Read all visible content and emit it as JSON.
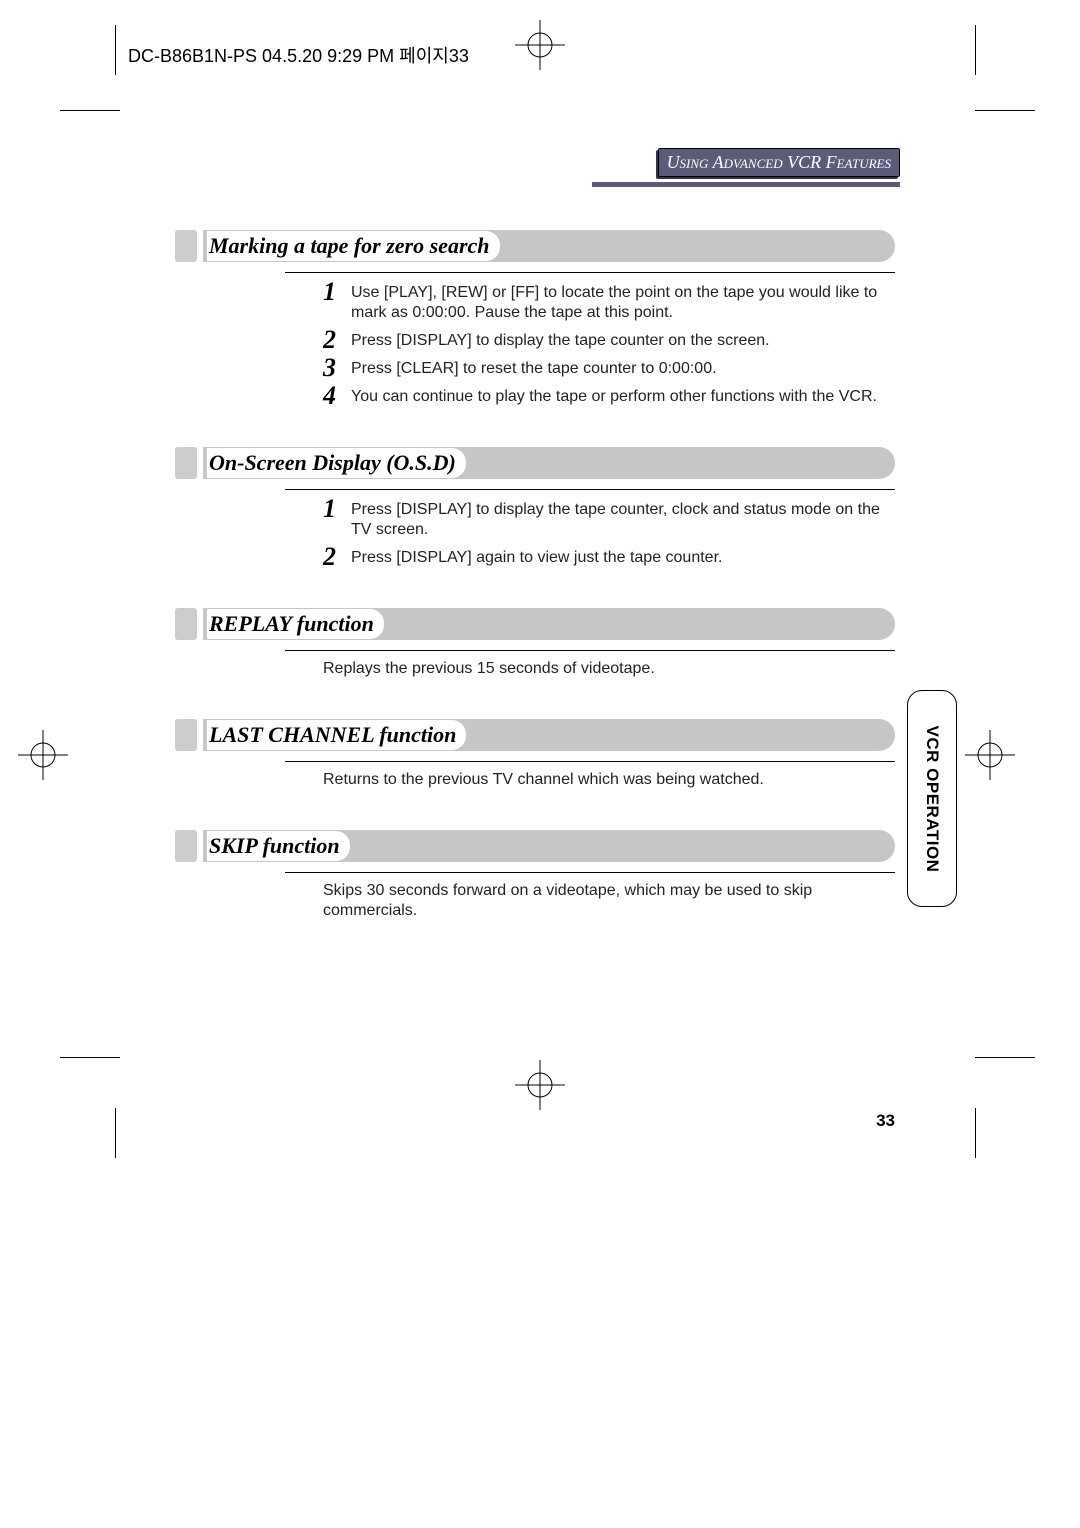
{
  "header": "DC-B86B1N-PS  04.5.20 9:29 PM  페이지33",
  "toplabel": "Using Advanced VCR Features",
  "sidetab": "VCR OPERATION",
  "sections": {
    "zero": {
      "title": "Marking a tape for zero search",
      "steps": [
        "Use [PLAY], [REW] or [FF] to locate the point on the tape you would like to mark as 0:00:00. Pause the tape at this point.",
        "Press [DISPLAY] to display  the tape counter on the screen.",
        "Press [CLEAR] to reset the tape counter to 0:00:00.",
        "You can continue to play the tape or perform other functions with the VCR."
      ]
    },
    "osd": {
      "title": "On-Screen Display (O.S.D)",
      "steps": [
        "Press [DISPLAY]  to display the tape counter, clock and  status mode on the TV screen.",
        "Press [DISPLAY] again to view just the tape counter."
      ]
    },
    "replay": {
      "title": "REPLAY function",
      "text": "Replays the previous 15 seconds of videotape."
    },
    "last": {
      "title": "LAST CHANNEL function",
      "text": "Returns to the previous TV channel which was being watched."
    },
    "skip": {
      "title": "SKIP function",
      "text": "Skips 30 seconds forward on a videotape, which may be used to skip commercials."
    }
  },
  "pagenum": "33",
  "nums": {
    "n1": "1",
    "n2": "2",
    "n3": "3",
    "n4": "4"
  }
}
